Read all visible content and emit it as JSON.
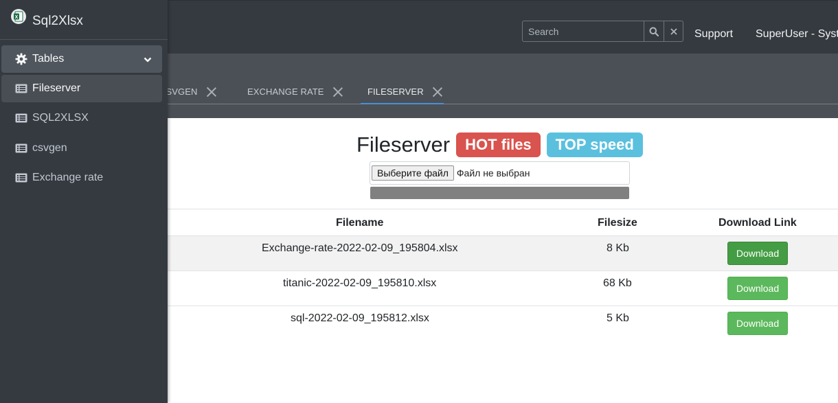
{
  "app": {
    "brand": "Sql2Xlsx",
    "brand_icon": "excel-icon"
  },
  "topbar": {
    "search_placeholder": "Search",
    "links": [
      "Support",
      "SuperUser - System"
    ]
  },
  "sidebar": {
    "group": {
      "label": "Tables",
      "icon": "gear-icon"
    },
    "items": [
      {
        "label": "Fileserver",
        "icon": "list-icon",
        "active": true
      },
      {
        "label": "SQL2XLSX",
        "icon": "list-icon",
        "active": false
      },
      {
        "label": "csvgen",
        "icon": "list-icon",
        "active": false
      },
      {
        "label": "Exchange rate",
        "icon": "list-icon",
        "active": false
      }
    ]
  },
  "tabs": [
    {
      "label": "CSVGEN",
      "active": false
    },
    {
      "label": "EXCHANGE RATE",
      "active": false
    },
    {
      "label": "FILESERVER",
      "active": true
    }
  ],
  "main": {
    "title": "Fileserver",
    "badge_hot": "HOT files",
    "badge_top": "TOP speed",
    "file_button": "Выберите файл",
    "file_status": "Файл не выбран",
    "progress_fraction": 1.0
  },
  "table": {
    "headers": [
      "Filename",
      "Filesize",
      "Download Link"
    ],
    "rows": [
      {
        "filename": "Exchange-rate-2022-02-09_195804.xlsx",
        "size": "8 Kb",
        "link": "Download"
      },
      {
        "filename": "titanic-2022-02-09_195810.xlsx",
        "size": "68 Kb",
        "link": "Download"
      },
      {
        "filename": "sql-2022-02-09_195812.xlsx",
        "size": "5 Kb",
        "link": "Download"
      }
    ]
  },
  "colors": {
    "navbar": "#343a40",
    "hot_badge": "#d9534f",
    "top_badge": "#5bc0de",
    "download_button": "#5cb85c",
    "active_tab_underline": "#4a90d9"
  }
}
